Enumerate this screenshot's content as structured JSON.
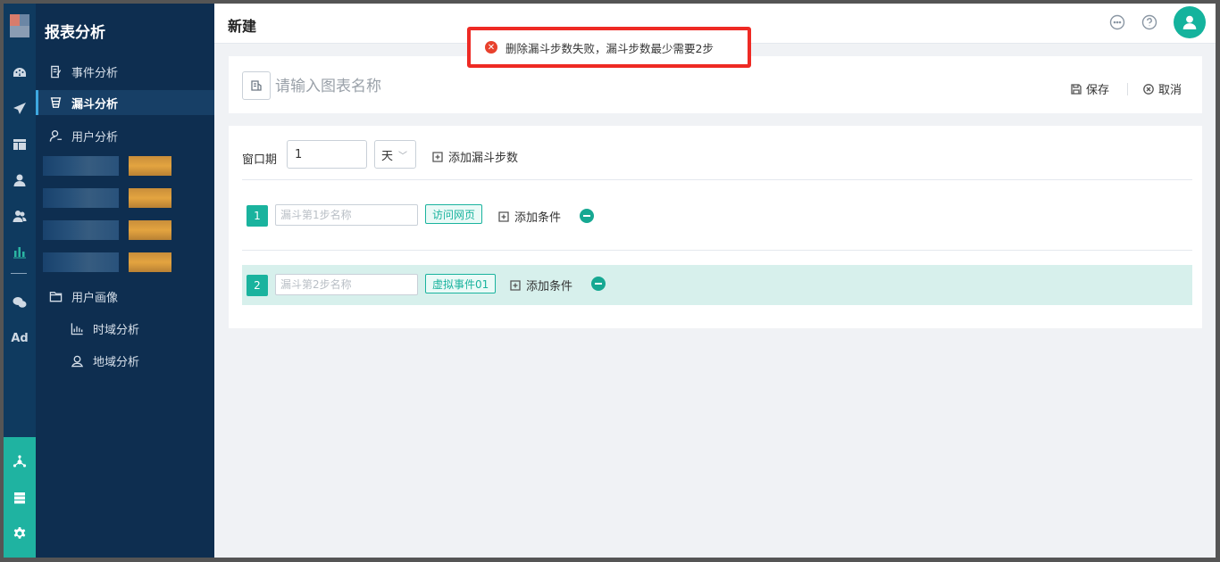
{
  "sidebar": {
    "title": "报表分析",
    "items": [
      {
        "label": "事件分析"
      },
      {
        "label": "漏斗分析"
      },
      {
        "label": "用户分析"
      },
      {
        "label": "用户画像"
      },
      {
        "label": "时域分析"
      },
      {
        "label": "地域分析"
      }
    ]
  },
  "rail": {
    "ad_label": "Ad"
  },
  "topbar": {
    "title": "新建"
  },
  "toast": {
    "message": "删除漏斗步数失败，漏斗步数最少需要2步"
  },
  "header_card": {
    "name_placeholder": "请输入图表名称",
    "save_label": "保存",
    "cancel_label": "取消"
  },
  "funnel": {
    "window_label": "窗口期",
    "window_value": "1",
    "unit_value": "天",
    "add_step_label": "添加漏斗步数",
    "steps": [
      {
        "number": "1",
        "placeholder": "漏斗第1步名称",
        "event": "访问网页",
        "add_condition_label": "添加条件"
      },
      {
        "number": "2",
        "placeholder": "漏斗第2步名称",
        "event": "虚拟事件01",
        "add_condition_label": "添加条件"
      }
    ]
  },
  "colors": {
    "sidebar_bg": "#0e2e50",
    "accent": "#1ab39e",
    "toast_border": "#ee2a24"
  }
}
